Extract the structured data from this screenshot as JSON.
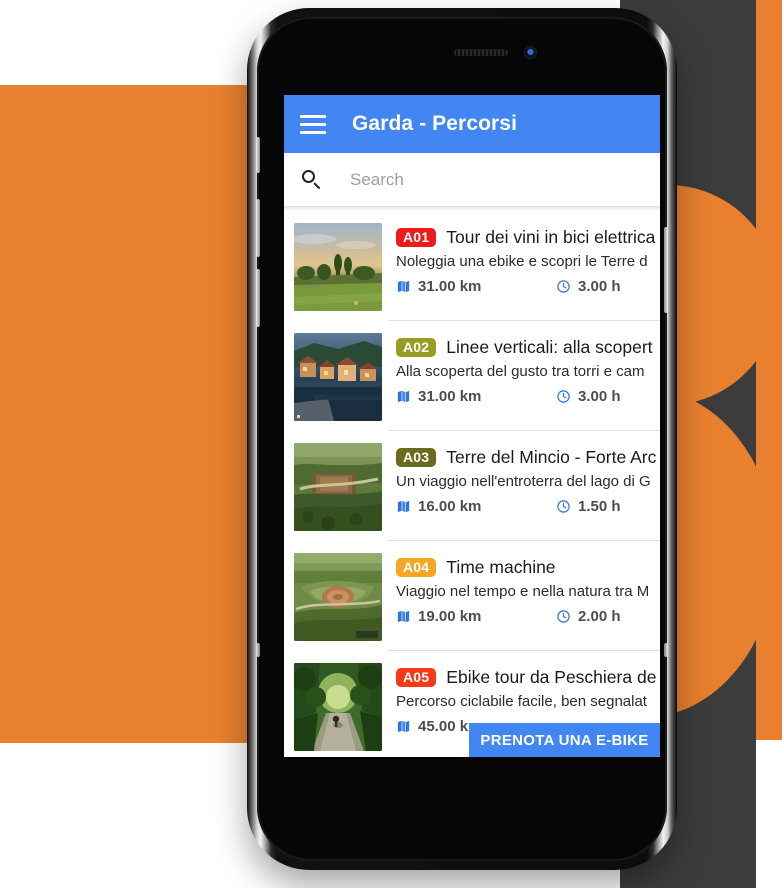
{
  "theme": {
    "brand_blue": "#4286F4",
    "background_orange": "#E9802F",
    "background_dark": "#3C3C3C"
  },
  "appbar": {
    "menu_icon": "hamburger-icon",
    "title": "Garda - Percorsi"
  },
  "search": {
    "icon": "search-icon",
    "placeholder": "Search",
    "value": ""
  },
  "cta": {
    "label": "PRENOTA UNA E-BIKE"
  },
  "list": {
    "items": [
      {
        "code": "A01",
        "code_color": "#EE1B1B",
        "title": "Tour dei vini in bici elettrica",
        "subtitle": "Noleggia una ebike e scopri le Terre d",
        "distance": "31.00 km",
        "duration": "3.00 h",
        "distance_icon": "map-icon",
        "duration_icon": "clock-icon",
        "thumb": "countryside-sunset-photo"
      },
      {
        "code": "A02",
        "code_color": "#9A9B22",
        "title": "Linee verticali: alla scopert",
        "subtitle": "Alla scoperta del gusto tra torri e cam",
        "distance": "31.00 km",
        "duration": "3.00 h",
        "distance_icon": "map-icon",
        "duration_icon": "clock-icon",
        "thumb": "lakeside-village-dusk-photo"
      },
      {
        "code": "A03",
        "code_color": "#6B6B1E",
        "title": "Terre del Mincio - Forte Arc",
        "subtitle": "Un viaggio nell'entroterra del lago di G",
        "distance": "16.00 km",
        "duration": "1.50 h",
        "distance_icon": "map-icon",
        "duration_icon": "clock-icon",
        "thumb": "aerial-fortress-photo"
      },
      {
        "code": "A04",
        "code_color": "#F5A623",
        "title": "Time machine",
        "subtitle": "Viaggio nel tempo e nella natura tra M",
        "distance": "19.00 km",
        "duration": "2.00 h",
        "distance_icon": "map-icon",
        "duration_icon": "clock-icon",
        "thumb": "aerial-round-fort-photo"
      },
      {
        "code": "A05",
        "code_color": "#F43A18",
        "title": "Ebike tour da Peschiera de",
        "subtitle": "Percorso ciclabile facile, ben segnalat",
        "distance": "45.00 k",
        "duration": "",
        "distance_icon": "map-icon",
        "duration_icon": "clock-icon",
        "thumb": "tree-lined-path-photo"
      }
    ]
  }
}
